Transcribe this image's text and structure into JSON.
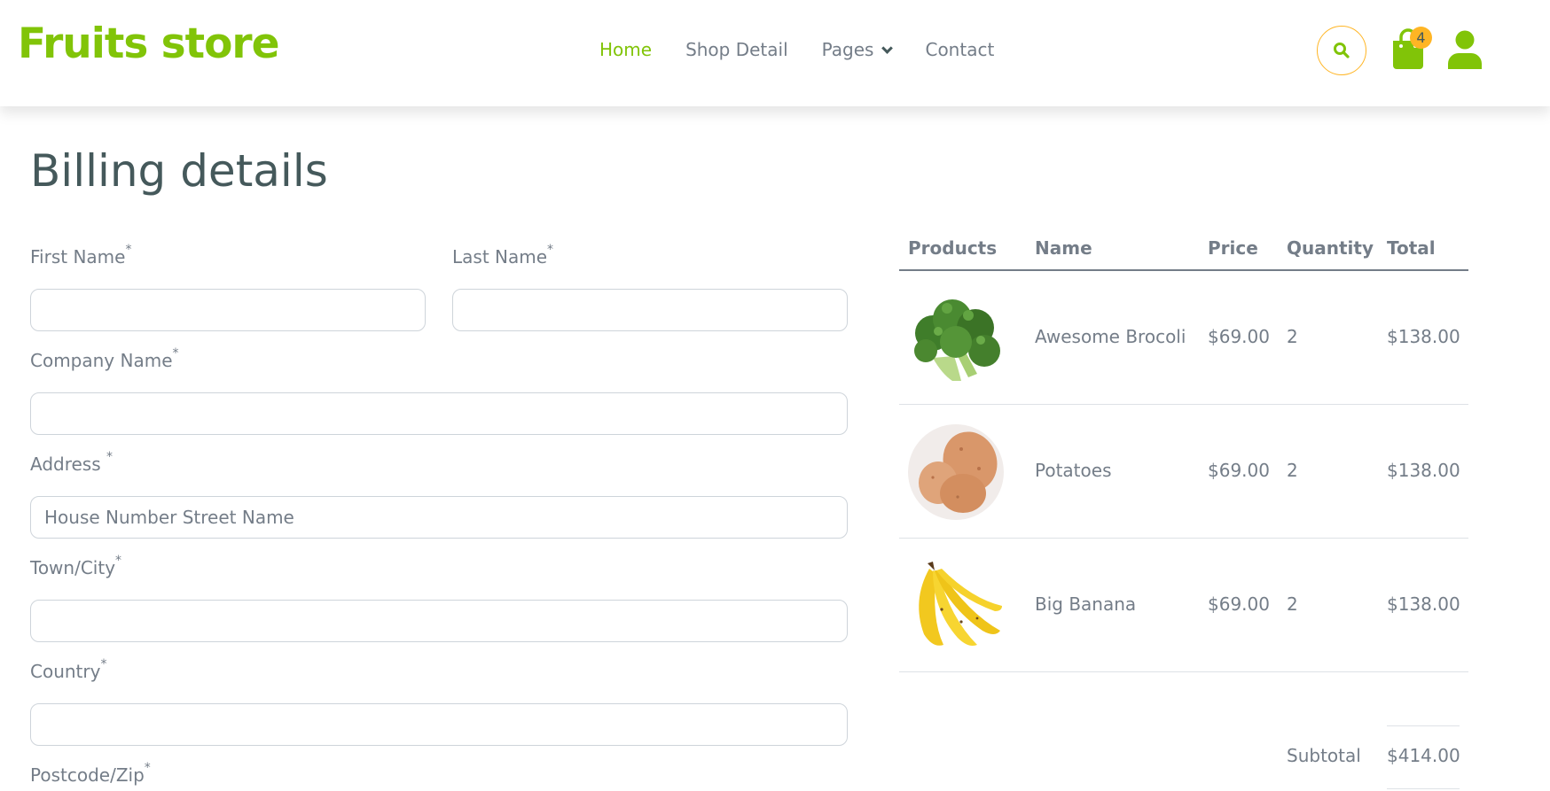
{
  "header": {
    "logo": "Fruits store",
    "nav": [
      {
        "label": "Home",
        "active": true
      },
      {
        "label": "Shop Detail",
        "active": false
      },
      {
        "label": "Pages",
        "active": false,
        "dropdown": true
      },
      {
        "label": "Contact",
        "active": false
      }
    ],
    "cart_count": "4",
    "icons": {
      "search": "search-icon",
      "cart": "shopping-bag-icon",
      "user": "user-icon"
    }
  },
  "billing": {
    "title": "Billing details",
    "required_mark": "*",
    "first_name": {
      "label": "First Name",
      "value": ""
    },
    "last_name": {
      "label": "Last Name",
      "value": ""
    },
    "company": {
      "label": "Company Name",
      "value": ""
    },
    "address": {
      "label": "Address ",
      "placeholder": "House Number Street Name"
    },
    "town": {
      "label": "Town/City",
      "value": ""
    },
    "country": {
      "label": "Country",
      "value": ""
    },
    "postcode": {
      "label": "Postcode/Zip",
      "value": ""
    }
  },
  "order": {
    "columns": [
      "Products",
      "Name",
      "Price",
      "Quantity",
      "Total"
    ],
    "rows": [
      {
        "image": "broccoli-image",
        "name": "Awesome Brocoli",
        "price": "$69.00",
        "qty": "2",
        "total": "$138.00"
      },
      {
        "image": "potatoes-image",
        "name": "Potatoes",
        "price": "$69.00",
        "qty": "2",
        "total": "$138.00"
      },
      {
        "image": "banana-image",
        "name": "Big Banana",
        "price": "$69.00",
        "qty": "2",
        "total": "$138.00"
      }
    ],
    "subtotal_label": "Subtotal",
    "subtotal_value": "$414.00"
  },
  "colors": {
    "brand": "#81c408",
    "accent": "#ffb524",
    "heading": "#45595b",
    "text": "#747d88"
  }
}
